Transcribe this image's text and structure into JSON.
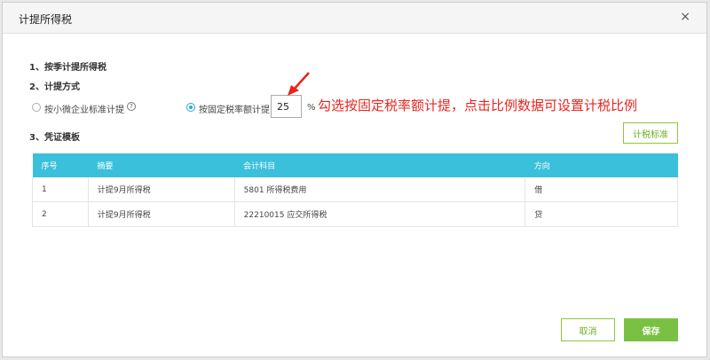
{
  "dialog": {
    "title": "计提所得税",
    "close_glyph": "×"
  },
  "sections": {
    "s1": "1、按季计提所得税",
    "s2": "2、计提方式",
    "s3": "3、凭证模板"
  },
  "method": {
    "option_small": "按小微企业标准计提",
    "option_fixed": "按固定税率额计提",
    "rate_value": "25",
    "rate_unit": "%",
    "selected": "option_fixed"
  },
  "annotation": "勾选按固定税率额计提，点击比例数据可设置计税比例",
  "buttons": {
    "tax_standard": "计税标准",
    "cancel": "取消",
    "save": "保存"
  },
  "table": {
    "headers": [
      "序号",
      "摘要",
      "会计科目",
      "方向"
    ],
    "rows": [
      [
        "1",
        "计提9月所得税",
        "5801 所得税费用",
        "借"
      ],
      [
        "2",
        "计提9月所得税",
        "22210015 应交所得税",
        "贷"
      ]
    ]
  },
  "colors": {
    "header_bg": "#3bc0dc",
    "accent_green": "#7ac143",
    "annotation_red": "#e8261f"
  }
}
